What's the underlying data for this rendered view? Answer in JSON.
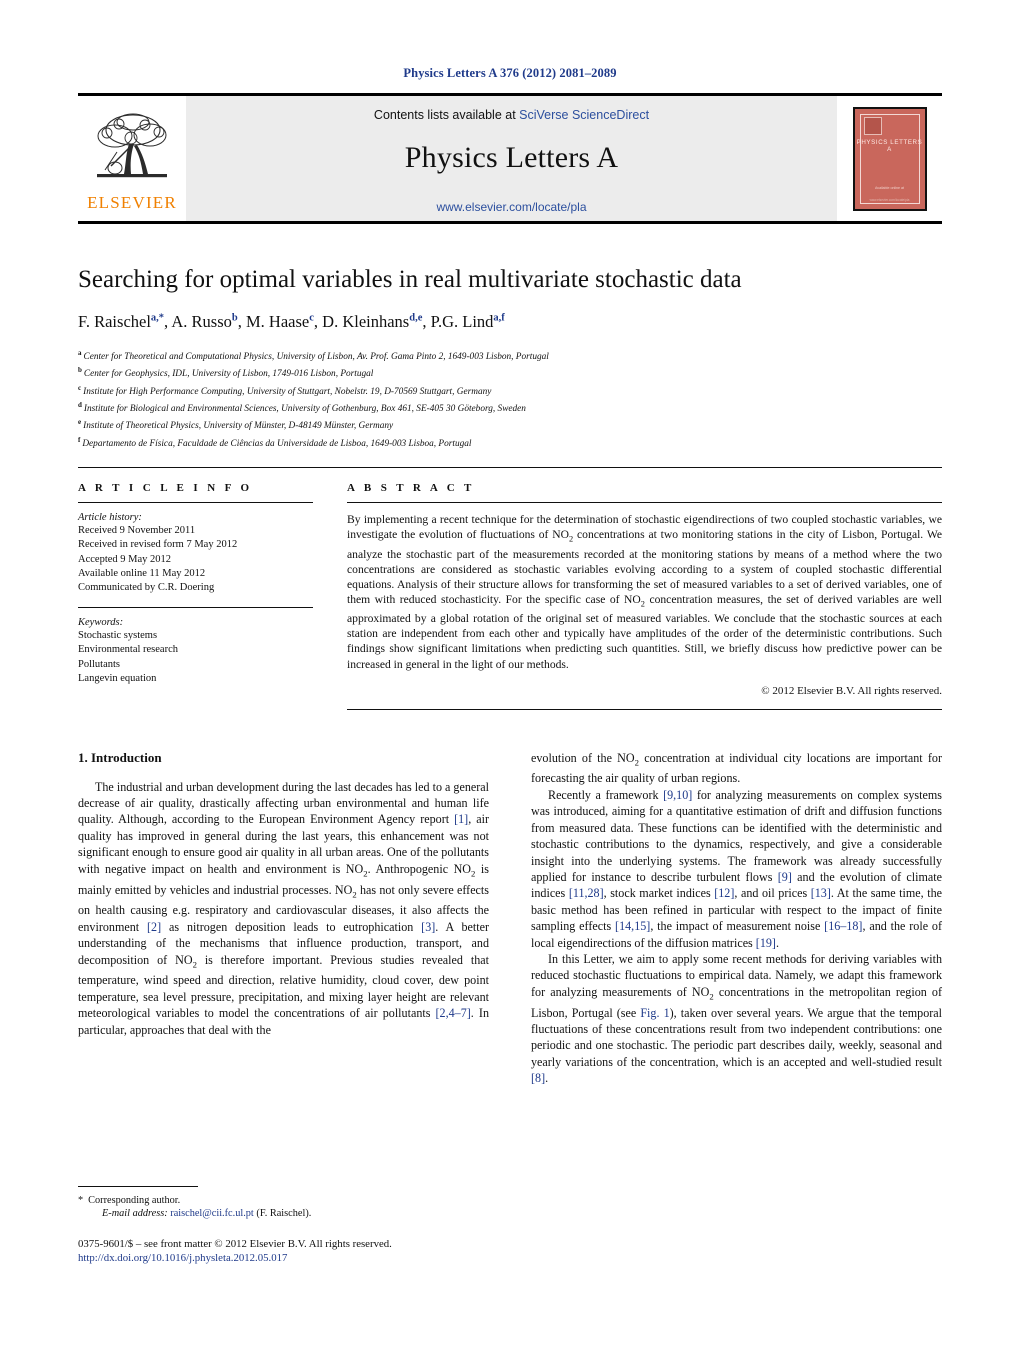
{
  "running_head": "Physics Letters A 376 (2012) 2081–2089",
  "masthead": {
    "publisher_name": "ELSEVIER",
    "contents_prefix": "Contents lists available at ",
    "contents_link": "SciVerse ScienceDirect",
    "journal_title": "Physics Letters A",
    "journal_url": "www.elsevier.com/locate/pla",
    "cover_title": "PHYSICS LETTERS A",
    "cover_foot": "Available online at",
    "cover_foot2": "www.elsevier.com/locate/pla"
  },
  "article": {
    "title": "Searching for optimal variables in real multivariate stochastic data",
    "authors": [
      {
        "name": "F. Raischel",
        "marks": "a,*"
      },
      {
        "name": "A. Russo",
        "marks": "b"
      },
      {
        "name": "M. Haase",
        "marks": "c"
      },
      {
        "name": "D. Kleinhans",
        "marks": "d,e"
      },
      {
        "name": "P.G. Lind",
        "marks": "a,f"
      }
    ],
    "affiliations": [
      {
        "mark": "a",
        "text": "Center for Theoretical and Computational Physics, University of Lisbon, Av. Prof. Gama Pinto 2, 1649-003 Lisbon, Portugal"
      },
      {
        "mark": "b",
        "text": "Center for Geophysics, IDL, University of Lisbon, 1749-016 Lisbon, Portugal"
      },
      {
        "mark": "c",
        "text": "Institute for High Performance Computing, University of Stuttgart, Nobelstr. 19, D-70569 Stuttgart, Germany"
      },
      {
        "mark": "d",
        "text": "Institute for Biological and Environmental Sciences, University of Gothenburg, Box 461, SE-405 30 Göteborg, Sweden"
      },
      {
        "mark": "e",
        "text": "Institute of Theoretical Physics, University of Münster, D-48149 Münster, Germany"
      },
      {
        "mark": "f",
        "text": "Departamento de Física, Faculdade de Ciências da Universidade de Lisboa, 1649-003 Lisboa, Portugal"
      }
    ]
  },
  "article_info": {
    "heading": "A R T I C L E  I N F O",
    "history_label": "Article history:",
    "history": [
      "Received 9 November 2011",
      "Received in revised form 7 May 2012",
      "Accepted 9 May 2012",
      "Available online 11 May 2012",
      "Communicated by C.R. Doering"
    ],
    "keywords_label": "Keywords:",
    "keywords": [
      "Stochastic systems",
      "Environmental research",
      "Pollutants",
      "Langevin equation"
    ]
  },
  "abstract": {
    "heading": "A B S T R A C T",
    "text_parts": [
      "By implementing a recent technique for the determination of stochastic eigendirections of two coupled stochastic variables, we investigate the evolution of fluctuations of NO",
      "2",
      " concentrations at two monitoring stations in the city of Lisbon, Portugal. We analyze the stochastic part of the measurements recorded at the monitoring stations by means of a method where the two concentrations are considered as stochastic variables evolving according to a system of coupled stochastic differential equations. Analysis of their structure allows for transforming the set of measured variables to a set of derived variables, one of them with reduced stochasticity. For the specific case of NO",
      "2",
      " concentration measures, the set of derived variables are well approximated by a global rotation of the original set of measured variables. We conclude that the stochastic sources at each station are independent from each other and typically have amplitudes of the order of the deterministic contributions. Such findings show significant limitations when predicting such quantities. Still, we briefly discuss how predictive power can be increased in general in the light of our methods."
    ],
    "copyright": "© 2012 Elsevier B.V. All rights reserved."
  },
  "body": {
    "section_title": "1. Introduction",
    "left_paragraphs": [
      {
        "segments": [
          {
            "t": "The industrial and urban development during the last decades has led to a general decrease of air quality, drastically affecting urban environmental and human life quality. Although, according to the European Environment Agency report "
          },
          {
            "t": "[1]",
            "k": "cite"
          },
          {
            "t": ", air quality has improved in general during the last years, this enhancement was not significant enough to ensure good air quality in all urban areas. One of the pollutants with negative impact on health and environment is NO"
          },
          {
            "t": "2",
            "k": "sub"
          },
          {
            "t": ". Anthropogenic NO"
          },
          {
            "t": "2",
            "k": "sub"
          },
          {
            "t": " is mainly emitted by vehicles and industrial processes. NO"
          },
          {
            "t": "2",
            "k": "sub"
          },
          {
            "t": " has not only severe effects on health causing e.g. respiratory and cardiovascular diseases, it also affects the environment "
          },
          {
            "t": "[2]",
            "k": "cite"
          },
          {
            "t": " as nitrogen deposition leads to eutrophication "
          },
          {
            "t": "[3]",
            "k": "cite"
          },
          {
            "t": ". A better understanding of the mechanisms that influence production, transport, and decomposition of NO"
          },
          {
            "t": "2",
            "k": "sub"
          },
          {
            "t": " is therefore important. Previous studies revealed that temperature, wind speed and direction, relative humidity, cloud cover, dew point temperature, sea level pressure, precipitation, and mixing layer height are relevant meteorological variables to model the concentrations of air pollutants "
          },
          {
            "t": "[2,4–7]",
            "k": "cite"
          },
          {
            "t": ". In particular, approaches that deal with the"
          }
        ]
      }
    ],
    "right_paragraphs": [
      {
        "noindent": true,
        "segments": [
          {
            "t": "evolution of the NO"
          },
          {
            "t": "2",
            "k": "sub"
          },
          {
            "t": " concentration at individual city locations are important for forecasting the air quality of urban regions."
          }
        ]
      },
      {
        "segments": [
          {
            "t": "Recently a framework "
          },
          {
            "t": "[9,10]",
            "k": "cite"
          },
          {
            "t": " for analyzing measurements on complex systems was introduced, aiming for a quantitative estimation of drift and diffusion functions from measured data. These functions can be identified with the deterministic and stochastic contributions to the dynamics, respectively, and give a considerable insight into the underlying systems. The framework was already successfully applied for instance to describe turbulent flows "
          },
          {
            "t": "[9]",
            "k": "cite"
          },
          {
            "t": " and the evolution of climate indices "
          },
          {
            "t": "[11,28]",
            "k": "cite"
          },
          {
            "t": ", stock market indices "
          },
          {
            "t": "[12]",
            "k": "cite"
          },
          {
            "t": ", and oil prices "
          },
          {
            "t": "[13]",
            "k": "cite"
          },
          {
            "t": ". At the same time, the basic method has been refined in particular with respect to the impact of finite sampling effects "
          },
          {
            "t": "[14,15]",
            "k": "cite"
          },
          {
            "t": ", the impact of measurement noise "
          },
          {
            "t": "[16–18]",
            "k": "cite"
          },
          {
            "t": ", and the role of local eigendirections of the diffusion matrices "
          },
          {
            "t": "[19]",
            "k": "cite"
          },
          {
            "t": "."
          }
        ]
      },
      {
        "segments": [
          {
            "t": "In this Letter, we aim to apply some recent methods for deriving variables with reduced stochastic fluctuations to empirical data. Namely, we adapt this framework for analyzing measurements of NO"
          },
          {
            "t": "2",
            "k": "sub"
          },
          {
            "t": " concentrations in the metropolitan region of Lisbon, Portugal (see "
          },
          {
            "t": "Fig. 1",
            "k": "cite"
          },
          {
            "t": "), taken over several years. We argue that the temporal fluctuations of these concentrations result from two independent contributions: one periodic and one stochastic. The periodic part describes daily, weekly, seasonal and yearly variations of the concentration, which is an accepted and well-studied result "
          },
          {
            "t": "[8]",
            "k": "cite"
          },
          {
            "t": "."
          }
        ]
      }
    ]
  },
  "footnotes": {
    "corresponding_marker": "*",
    "corresponding_text": "Corresponding author.",
    "email_label": "E-mail address:",
    "email": "raischel@cii.fc.ul.pt",
    "email_owner": "(F. Raischel).",
    "issn_line": "0375-9601/$ – see front matter  © 2012 Elsevier B.V. All rights reserved.",
    "doi": "http://dx.doi.org/10.1016/j.physleta.2012.05.017"
  },
  "colors": {
    "link_blue": "#1f3a8a",
    "elsevier_orange": "#f08000",
    "masthead_gray": "#ececec",
    "cover_red": "#c9675c"
  }
}
